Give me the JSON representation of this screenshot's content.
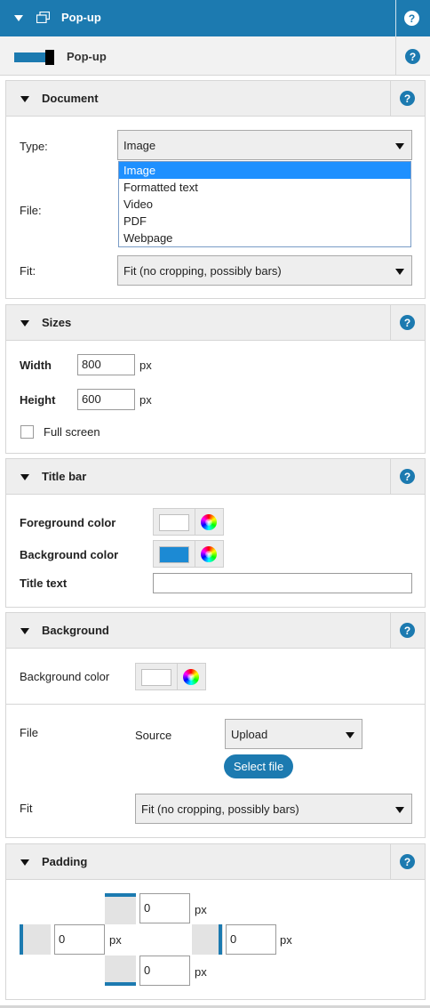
{
  "header": {
    "title": "Pop-up",
    "help": "?"
  },
  "subheader": {
    "label": "Pop-up",
    "help": "?"
  },
  "document": {
    "title": "Document",
    "type_label": "Type:",
    "type_value": "Image",
    "type_options": [
      "Image",
      "Formatted text",
      "Video",
      "PDF",
      "Webpage"
    ],
    "file_label": "File:",
    "fit_label": "Fit:",
    "fit_value": "Fit (no cropping, possibly bars)"
  },
  "sizes": {
    "title": "Sizes",
    "width_label": "Width",
    "width_value": "800",
    "height_label": "Height",
    "height_value": "600",
    "unit": "px",
    "fullscreen_label": "Full screen"
  },
  "titlebar": {
    "title": "Title bar",
    "fg_label": "Foreground color",
    "fg_color": "#ffffff",
    "bg_label": "Background color",
    "bg_color": "#1c8ad4",
    "text_label": "Title text",
    "text_value": ""
  },
  "background": {
    "title": "Background",
    "color_label": "Background color",
    "color": "#ffffff",
    "file_label": "File",
    "source_label": "Source",
    "source_value": "Upload",
    "select_file_button": "Select file",
    "fit_label": "Fit",
    "fit_value": "Fit (no cropping, possibly bars)"
  },
  "padding": {
    "title": "Padding",
    "top": "0",
    "left": "0",
    "right": "0",
    "bottom": "0",
    "unit": "px"
  },
  "colors": {
    "accent": "#1c7ab0",
    "selected_option": "#1e90ff"
  }
}
